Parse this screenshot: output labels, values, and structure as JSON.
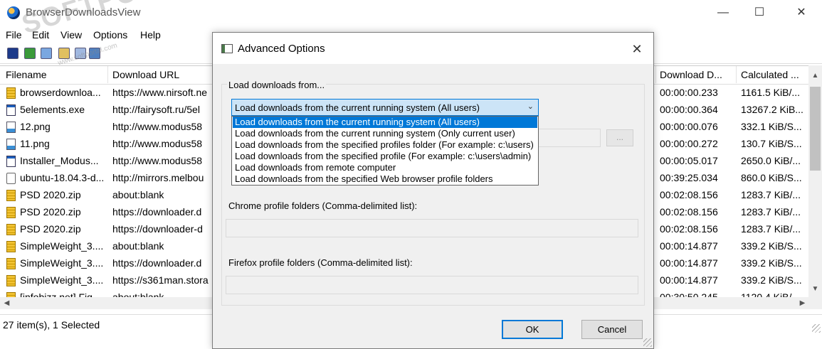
{
  "window": {
    "title": "BrowserDownloadsView",
    "minimize": "—",
    "maximize": "☐",
    "close": "✕"
  },
  "menu": [
    "File",
    "Edit",
    "View",
    "Options",
    "Help"
  ],
  "watermark": {
    "main": "SOFTPORTAL",
    "sub": "www.softportal.com",
    "tm": "™"
  },
  "list": {
    "columns": [
      "Filename",
      "Download URL",
      "Download D...",
      "Calculated ..."
    ],
    "rows": [
      {
        "icon": "zip",
        "filename": "browserdownloa...",
        "url": "https://www.nirsoft.ne",
        "duration": "00:00:00.233",
        "speed": "1161.5 KiB/..."
      },
      {
        "icon": "exe",
        "filename": "5elements.exe",
        "url": "http://fairysoft.ru/5el",
        "duration": "00:00:00.364",
        "speed": "13267.2 KiB..."
      },
      {
        "icon": "img",
        "filename": "12.png",
        "url": "http://www.modus58",
        "duration": "00:00:00.076",
        "speed": "332.1 KiB/S..."
      },
      {
        "icon": "img",
        "filename": "11.png",
        "url": "http://www.modus58",
        "duration": "00:00:00.272",
        "speed": "130.7 KiB/S..."
      },
      {
        "icon": "exe",
        "filename": "Installer_Modus...",
        "url": "http://www.modus58",
        "duration": "00:00:05.017",
        "speed": "2650.0 KiB/..."
      },
      {
        "icon": "iso",
        "filename": "ubuntu-18.04.3-d...",
        "url": "http://mirrors.melbou",
        "duration": "00:39:25.034",
        "speed": "860.0 KiB/S..."
      },
      {
        "icon": "zip",
        "filename": "PSD 2020.zip",
        "url": "about:blank",
        "duration": "00:02:08.156",
        "speed": "1283.7 KiB/..."
      },
      {
        "icon": "zip",
        "filename": "PSD 2020.zip",
        "url": "https://downloader.d",
        "duration": "00:02:08.156",
        "speed": "1283.7 KiB/..."
      },
      {
        "icon": "zip",
        "filename": "PSD 2020.zip",
        "url": "https://downloader-d",
        "duration": "00:02:08.156",
        "speed": "1283.7 KiB/..."
      },
      {
        "icon": "zip",
        "filename": "SimpleWeight_3....",
        "url": "about:blank",
        "duration": "00:00:14.877",
        "speed": "339.2 KiB/S..."
      },
      {
        "icon": "zip",
        "filename": "SimpleWeight_3....",
        "url": "https://downloader.d",
        "duration": "00:00:14.877",
        "speed": "339.2 KiB/S..."
      },
      {
        "icon": "zip",
        "filename": "SimpleWeight_3....",
        "url": "https://s361man.stora",
        "duration": "00:00:14.877",
        "speed": "339.2 KiB/S..."
      },
      {
        "icon": "zip",
        "filename": "[infobizz.net] Fig...",
        "url": "about:blank",
        "duration": "00:30:50.245",
        "speed": "1120.4 KiB/..."
      }
    ]
  },
  "status": {
    "text": "27 item(s), 1 Selected"
  },
  "dialog": {
    "title": "Advanced Options",
    "close": "✕",
    "group_label": "Load downloads from...",
    "combo_value": "Load downloads from the current running system (All users)",
    "combo_arrow": "⌄",
    "options": [
      "Load downloads from the current running system (All users)",
      "Load downloads from the current running system (Only current user)",
      "Load downloads from the specified profiles folder (For example: c:\\users)",
      "Load downloads from the specified profile (For example: c:\\users\\admin)",
      "Load downloads from remote computer",
      "Load downloads from the specified Web browser profile folders"
    ],
    "browse_label": "...",
    "chrome_label": "Chrome profile folders (Comma-delimited list):",
    "firefox_label": "Firefox profile folders (Comma-delimited list):",
    "ok_label": "OK",
    "cancel_label": "Cancel"
  }
}
